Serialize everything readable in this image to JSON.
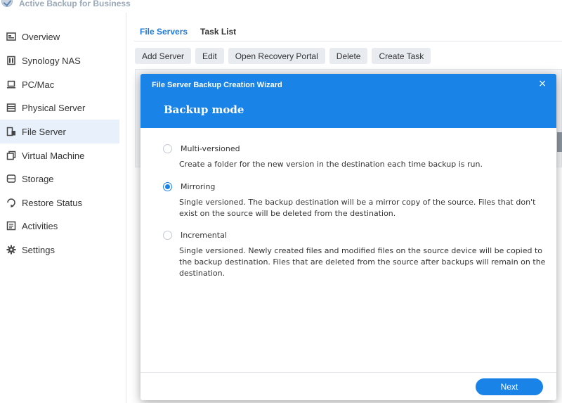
{
  "app": {
    "title": "Active Backup for Business"
  },
  "sidebar": {
    "items": [
      {
        "label": "Overview",
        "icon": "overview-icon"
      },
      {
        "label": "Synology NAS",
        "icon": "nas-icon"
      },
      {
        "label": "PC/Mac",
        "icon": "laptop-icon"
      },
      {
        "label": "Physical Server",
        "icon": "server-icon"
      },
      {
        "label": "File Server",
        "icon": "file-server-icon",
        "active": true
      },
      {
        "label": "Virtual Machine",
        "icon": "virtual-machine-icon"
      },
      {
        "label": "Storage",
        "icon": "storage-icon"
      },
      {
        "label": "Restore Status",
        "icon": "restore-icon"
      },
      {
        "label": "Activities",
        "icon": "activities-icon"
      },
      {
        "label": "Settings",
        "icon": "gear-icon"
      }
    ]
  },
  "main": {
    "tabs": [
      {
        "label": "File Servers",
        "active": true
      },
      {
        "label": "Task List"
      }
    ],
    "toolbar": [
      "Add Server",
      "Edit",
      "Open Recovery Portal",
      "Delete",
      "Create Task"
    ]
  },
  "wizard": {
    "title": "File Server Backup Creation Wizard",
    "subtitle": "Backup mode",
    "close": "×",
    "options": [
      {
        "label": "Multi-versioned",
        "desc": "Create a folder for the new version in the destination each time backup is run.",
        "selected": false
      },
      {
        "label": "Mirroring",
        "desc": "Single versioned. The backup destination will be a mirror copy of the source. Files that don't exist on the source will be deleted from the destination.",
        "selected": true
      },
      {
        "label": "Incremental",
        "desc": "Single versioned. Newly created files and modified files on the source device will be copied to the backup destination. Files that are deleted from the source after backups will remain on the destination.",
        "selected": false
      }
    ],
    "next_label": "Next"
  },
  "colors": {
    "accent": "#1983e8",
    "sidebar_active": "#e7f0fb"
  }
}
